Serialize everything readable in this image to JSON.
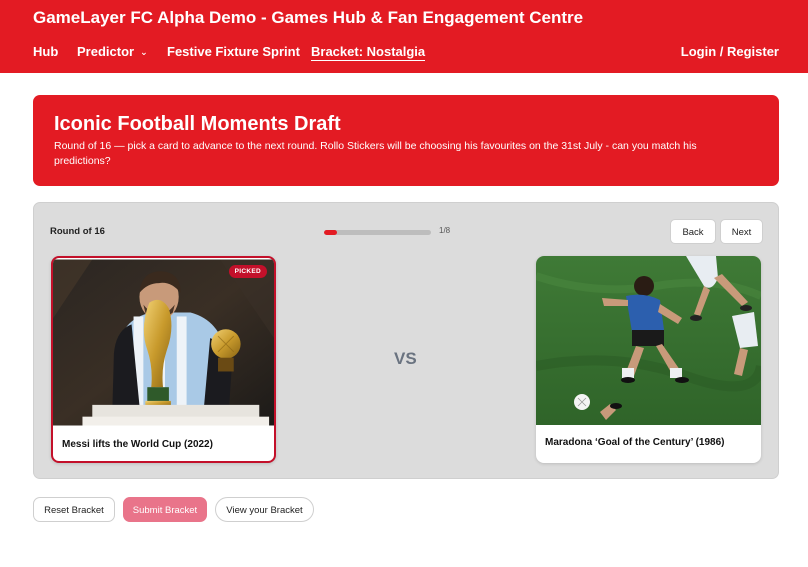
{
  "header": {
    "site_title": "GameLayer FC Alpha Demo - Games Hub & Fan Engagement Centre",
    "nav": [
      {
        "label": "Hub"
      },
      {
        "label": "Predictor",
        "icon": "chevron-down-icon"
      },
      {
        "label": "Festive Fixture Sprint"
      },
      {
        "label": "Bracket: Nostalgia"
      }
    ],
    "login_label": "Login / Register",
    "brand_color": "#e31b23"
  },
  "banner": {
    "title": "Iconic Football Moments Draft",
    "subtitle": "Round of 16 — pick a card to advance to the next round. Rollo Stickers will be choosing his favourites on the 31st July - can you match his predictions?"
  },
  "matchup": {
    "round_label": "Round of 16",
    "progress_text": "1/8",
    "progress_fraction": 0.125,
    "back_label": "Back",
    "next_label": "Next",
    "vs_label": "VS",
    "left_card": {
      "caption": "Messi lifts the World Cup (2022)",
      "badge": "PICKED"
    },
    "right_card": {
      "caption": "Maradona ‘Goal of the Century’ (1986)"
    }
  },
  "actions": {
    "reset_label": "Reset Bracket",
    "submit_label": "Submit Bracket",
    "view_label": "View your Bracket"
  }
}
